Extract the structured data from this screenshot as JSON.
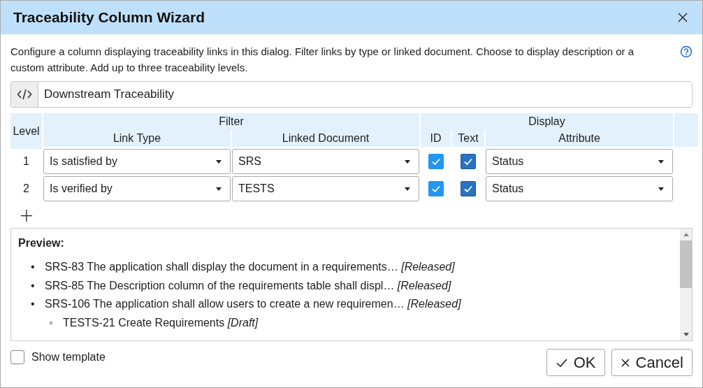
{
  "window": {
    "title": "Traceability Column Wizard"
  },
  "description": "Configure a column displaying traceability links in this dialog. Filter links by type or linked document. Choose to display description or a custom attribute. Add up to three traceability levels.",
  "column_name": {
    "value": "Downstream Traceability"
  },
  "table": {
    "groups": [
      "Filter",
      "Display"
    ],
    "columns": [
      "Level",
      "Link Type",
      "Linked Document",
      "ID",
      "Text",
      "Attribute"
    ],
    "rows": [
      {
        "level": "1",
        "link_type": "Is satisfied by",
        "linked_document": "SRS",
        "id_checked": true,
        "text_checked": true,
        "attribute": "Status"
      },
      {
        "level": "2",
        "link_type": "Is verified by",
        "linked_document": "TESTS",
        "id_checked": true,
        "text_checked": true,
        "attribute": "Status"
      }
    ],
    "add_symbol": "+"
  },
  "preview": {
    "heading": "Preview:",
    "items": [
      {
        "marker": "•",
        "text": "SRS-83 The application shall display the document in a requirements… *[Released]*"
      },
      {
        "marker": "•",
        "text": "SRS-85 The Description column of the requirements table shall displ… *[Released]*"
      },
      {
        "marker": "•",
        "text": "SRS-106 The application shall allow users to create a new requiremen… *[Released]*",
        "children": [
          {
            "marker": "◦",
            "text": "TESTS-21 Create Requirements *[Draft]*"
          }
        ]
      }
    ]
  },
  "show_template": {
    "label": "Show template",
    "checked": false
  },
  "buttons": [
    {
      "kind": "ok",
      "label": "OK"
    },
    {
      "kind": "cancel",
      "label": "Cancel"
    }
  ]
}
